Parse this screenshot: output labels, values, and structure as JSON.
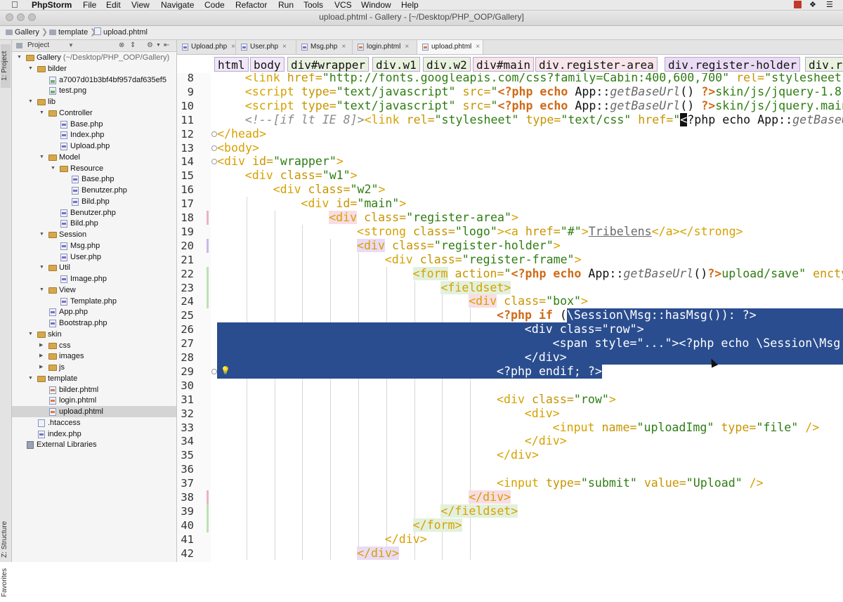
{
  "menubar": {
    "app_name": "PhpStorm",
    "items": [
      "File",
      "Edit",
      "View",
      "Navigate",
      "Code",
      "Refactor",
      "Run",
      "Tools",
      "VCS",
      "Window",
      "Help"
    ]
  },
  "window": {
    "title": "upload.phtml - Gallery - [~/Desktop/PHP_OOP/Gallery]"
  },
  "breadcrumb": [
    "Gallery",
    "template",
    "upload.phtml"
  ],
  "toolstrip": {
    "project_tab": "1: Project",
    "structure_tab": "Z: Structure",
    "favorites_tab": "Favorites"
  },
  "project_panel": {
    "view_label": "Project",
    "tree": [
      {
        "label": "Gallery",
        "hint": "(~/Desktop/PHP_OOP/Gallery)",
        "kind": "folder",
        "level": 0,
        "open": true
      },
      {
        "label": "bilder",
        "kind": "folder",
        "level": 1,
        "open": true
      },
      {
        "label": "a7007d01b3bf4bf957daf635ef5",
        "kind": "img",
        "level": 2
      },
      {
        "label": "test.png",
        "kind": "img",
        "level": 2
      },
      {
        "label": "lib",
        "kind": "folder",
        "level": 1,
        "open": true
      },
      {
        "label": "Controller",
        "kind": "folder",
        "level": 2,
        "open": true
      },
      {
        "label": "Base.php",
        "kind": "php",
        "level": 3
      },
      {
        "label": "Index.php",
        "kind": "php",
        "level": 3
      },
      {
        "label": "Upload.php",
        "kind": "php",
        "level": 3
      },
      {
        "label": "Model",
        "kind": "folder",
        "level": 2,
        "open": true
      },
      {
        "label": "Resource",
        "kind": "folder",
        "level": 3,
        "open": true
      },
      {
        "label": "Base.php",
        "kind": "php",
        "level": 4
      },
      {
        "label": "Benutzer.php",
        "kind": "php",
        "level": 4
      },
      {
        "label": "Bild.php",
        "kind": "php",
        "level": 4
      },
      {
        "label": "Benutzer.php",
        "kind": "php",
        "level": 3
      },
      {
        "label": "Bild.php",
        "kind": "php",
        "level": 3
      },
      {
        "label": "Session",
        "kind": "folder",
        "level": 2,
        "open": true
      },
      {
        "label": "Msg.php",
        "kind": "php",
        "level": 3
      },
      {
        "label": "User.php",
        "kind": "php",
        "level": 3
      },
      {
        "label": "Util",
        "kind": "folder",
        "level": 2,
        "open": true
      },
      {
        "label": "Image.php",
        "kind": "php",
        "level": 3
      },
      {
        "label": "View",
        "kind": "folder",
        "level": 2,
        "open": true
      },
      {
        "label": "Template.php",
        "kind": "php",
        "level": 3
      },
      {
        "label": "App.php",
        "kind": "php",
        "level": 2
      },
      {
        "label": "Bootstrap.php",
        "kind": "php",
        "level": 2
      },
      {
        "label": "skin",
        "kind": "folder",
        "level": 1,
        "open": true
      },
      {
        "label": "css",
        "kind": "folder",
        "level": 2,
        "open": false
      },
      {
        "label": "images",
        "kind": "folder",
        "level": 2,
        "open": false
      },
      {
        "label": "js",
        "kind": "folder",
        "level": 2,
        "open": false
      },
      {
        "label": "template",
        "kind": "folder",
        "level": 1,
        "open": true
      },
      {
        "label": "bilder.phtml",
        "kind": "html",
        "level": 2
      },
      {
        "label": "login.phtml",
        "kind": "html",
        "level": 2
      },
      {
        "label": "upload.phtml",
        "kind": "html",
        "level": 2,
        "selected": true
      },
      {
        "label": ".htaccess",
        "kind": "file",
        "level": 1
      },
      {
        "label": "index.php",
        "kind": "php",
        "level": 1
      },
      {
        "label": "External Libraries",
        "kind": "lib",
        "level": 0
      }
    ]
  },
  "tabs": [
    {
      "label": "Upload.php",
      "kind": "php"
    },
    {
      "label": "User.php",
      "kind": "php"
    },
    {
      "label": "Msg.php",
      "kind": "php"
    },
    {
      "label": "login.phtml",
      "kind": "html"
    },
    {
      "label": "upload.phtml",
      "kind": "html",
      "active": true
    }
  ],
  "tag_path": [
    "html",
    "body",
    "div#wrapper",
    "div.w1",
    "div.w2",
    "div#main",
    "div.register-area",
    "div.register-holder",
    "div.r"
  ],
  "editor": {
    "lines": [
      {
        "n": 8,
        "indent": 1,
        "tokens": [
          [
            "tg",
            "<link "
          ],
          [
            "at",
            "href="
          ],
          [
            "st",
            "\"http://fonts.googleapis.com/css?family=Cabin:400,600,700\" "
          ],
          [
            "at",
            "rel="
          ],
          [
            "st",
            "\"stylesheet\""
          ]
        ]
      },
      {
        "n": 9,
        "indent": 1,
        "tokens": [
          [
            "tg",
            "<script "
          ],
          [
            "at",
            "type="
          ],
          [
            "st",
            "\"text/javascript\" "
          ],
          [
            "at",
            "src="
          ],
          [
            "st",
            "\""
          ],
          [
            "ph",
            "<?php echo "
          ],
          [
            "tx",
            "App::"
          ],
          [
            "ui",
            "getBaseUrl"
          ],
          [
            "tx",
            "() "
          ],
          [
            "ph",
            "?>"
          ],
          [
            "st",
            "skin/js/jquery-1.8."
          ]
        ]
      },
      {
        "n": 10,
        "indent": 1,
        "tokens": [
          [
            "tg",
            "<script "
          ],
          [
            "at",
            "type="
          ],
          [
            "st",
            "\"text/javascript\" "
          ],
          [
            "at",
            "src="
          ],
          [
            "st",
            "\""
          ],
          [
            "ph",
            "<?php echo "
          ],
          [
            "tx",
            "App::"
          ],
          [
            "ui",
            "getBaseUrl"
          ],
          [
            "tx",
            "() "
          ],
          [
            "ph",
            "?>"
          ],
          [
            "st",
            "skin/js/jquery.main"
          ]
        ]
      },
      {
        "n": 11,
        "indent": 1,
        "tokens": [
          [
            "cm",
            "<!--[if lt IE 8]>"
          ],
          [
            "tg",
            "<link "
          ],
          [
            "at",
            "rel="
          ],
          [
            "st",
            "\"stylesheet\" "
          ],
          [
            "at",
            "type="
          ],
          [
            "st",
            "\"text/css\" "
          ],
          [
            "at",
            "href="
          ],
          [
            "st",
            "\""
          ],
          [
            "cur",
            "<"
          ],
          [
            "tx",
            "?php echo App::"
          ],
          [
            "ui",
            "getBaseUrl"
          ]
        ]
      },
      {
        "n": 12,
        "indent": 0,
        "tokens": [
          [
            "tg",
            "</head>"
          ]
        ]
      },
      {
        "n": 13,
        "indent": 0,
        "tokens": [
          [
            "tg",
            "<body>"
          ]
        ]
      },
      {
        "n": 14,
        "indent": 0,
        "tokens": [
          [
            "tg",
            "<div "
          ],
          [
            "at",
            "id="
          ],
          [
            "st",
            "\"wrapper\""
          ],
          [
            "tg",
            ">"
          ]
        ]
      },
      {
        "n": 15,
        "indent": 1,
        "tokens": [
          [
            "tg",
            "<div "
          ],
          [
            "at",
            "class="
          ],
          [
            "st",
            "\"w1\""
          ],
          [
            "tg",
            ">"
          ]
        ]
      },
      {
        "n": 16,
        "indent": 2,
        "tokens": [
          [
            "tg",
            "<div "
          ],
          [
            "at",
            "class="
          ],
          [
            "st",
            "\"w2\""
          ],
          [
            "tg",
            ">"
          ]
        ]
      },
      {
        "n": 17,
        "indent": 3,
        "tokens": [
          [
            "tg",
            "<div "
          ],
          [
            "at",
            "id="
          ],
          [
            "st",
            "\"main\""
          ],
          [
            "tg",
            ">"
          ]
        ]
      },
      {
        "n": 18,
        "indent": 4,
        "tokens": [
          [
            "h1",
            "<div"
          ],
          [
            "at",
            " class="
          ],
          [
            "st",
            "\"register-area\""
          ],
          [
            "tg",
            ">"
          ]
        ]
      },
      {
        "n": 19,
        "indent": 5,
        "tokens": [
          [
            "tg",
            "<strong "
          ],
          [
            "at",
            "class="
          ],
          [
            "st",
            "\"logo\""
          ],
          [
            "tg",
            "><a "
          ],
          [
            "at",
            "href="
          ],
          [
            "st",
            "\"#\""
          ],
          [
            "tg",
            ">"
          ],
          [
            "lk",
            "Tribelens"
          ],
          [
            "tg",
            "</a></strong>"
          ]
        ]
      },
      {
        "n": 20,
        "indent": 5,
        "tokens": [
          [
            "h2",
            "<div"
          ],
          [
            "at",
            " class="
          ],
          [
            "st",
            "\"register-holder\""
          ],
          [
            "tg",
            ">"
          ]
        ]
      },
      {
        "n": 21,
        "indent": 6,
        "tokens": [
          [
            "tg",
            "<div "
          ],
          [
            "at",
            "class="
          ],
          [
            "st",
            "\"register-frame\""
          ],
          [
            "tg",
            ">"
          ]
        ]
      },
      {
        "n": 22,
        "indent": 7,
        "tokens": [
          [
            "h3",
            "<form"
          ],
          [
            "at",
            " action="
          ],
          [
            "st",
            "\""
          ],
          [
            "ph",
            "<?php echo "
          ],
          [
            "tx",
            "App::"
          ],
          [
            "ui",
            "getBaseUrl"
          ],
          [
            "tx",
            "()"
          ],
          [
            "ph",
            "?>"
          ],
          [
            "st",
            "upload/save\" "
          ],
          [
            "at",
            "encty"
          ]
        ]
      },
      {
        "n": 23,
        "indent": 8,
        "tokens": [
          [
            "h3",
            "<fieldset>"
          ]
        ]
      },
      {
        "n": 24,
        "indent": 9,
        "tokens": [
          [
            "h1",
            "<div"
          ],
          [
            "at",
            " class="
          ],
          [
            "st",
            "\"box\""
          ],
          [
            "tg",
            ">"
          ]
        ]
      },
      {
        "n": 25,
        "indent": 10,
        "tokens": [
          [
            "ph",
            "<?php if "
          ],
          [
            "tx",
            "("
          ],
          [
            "sel",
            "\\Session\\Msg::hasMsg()): ?>"
          ]
        ]
      },
      {
        "n": 26,
        "indent": 11,
        "tokens": [
          [
            "sel",
            "<div class=\"row\">"
          ]
        ]
      },
      {
        "n": 27,
        "indent": 12,
        "tokens": [
          [
            "sel",
            "<span style=\"...\"><?php echo \\Session\\Msg:"
          ]
        ]
      },
      {
        "n": 28,
        "indent": 11,
        "tokens": [
          [
            "sel",
            "</div>"
          ]
        ]
      },
      {
        "n": 29,
        "indent": 10,
        "tokens": [
          [
            "sel",
            "<?php endif; ?>"
          ]
        ]
      },
      {
        "n": 30,
        "indent": 0,
        "tokens": []
      },
      {
        "n": 31,
        "indent": 10,
        "tokens": [
          [
            "tg",
            "<div "
          ],
          [
            "at",
            "class="
          ],
          [
            "st",
            "\"row\""
          ],
          [
            "tg",
            ">"
          ]
        ]
      },
      {
        "n": 32,
        "indent": 11,
        "tokens": [
          [
            "tg",
            "<div>"
          ]
        ]
      },
      {
        "n": 33,
        "indent": 12,
        "tokens": [
          [
            "tg",
            "<input "
          ],
          [
            "at",
            "name="
          ],
          [
            "st",
            "\"uploadImg\" "
          ],
          [
            "at",
            "type="
          ],
          [
            "st",
            "\"file\" "
          ],
          [
            "tg",
            "/>"
          ]
        ]
      },
      {
        "n": 34,
        "indent": 11,
        "tokens": [
          [
            "tg",
            "</div>"
          ]
        ]
      },
      {
        "n": 35,
        "indent": 10,
        "tokens": [
          [
            "tg",
            "</div>"
          ]
        ]
      },
      {
        "n": 36,
        "indent": 0,
        "tokens": []
      },
      {
        "n": 37,
        "indent": 10,
        "tokens": [
          [
            "tg",
            "<input "
          ],
          [
            "at",
            "type="
          ],
          [
            "st",
            "\"submit\" "
          ],
          [
            "at",
            "value="
          ],
          [
            "st",
            "\"Upload\" "
          ],
          [
            "tg",
            "/>"
          ]
        ]
      },
      {
        "n": 38,
        "indent": 9,
        "tokens": [
          [
            "h1",
            "</div>"
          ]
        ]
      },
      {
        "n": 39,
        "indent": 8,
        "tokens": [
          [
            "h3",
            "</fieldset>"
          ]
        ]
      },
      {
        "n": 40,
        "indent": 7,
        "tokens": [
          [
            "h3",
            "</form>"
          ]
        ]
      },
      {
        "n": 41,
        "indent": 6,
        "tokens": [
          [
            "tg",
            "</div>"
          ]
        ]
      },
      {
        "n": 42,
        "indent": 5,
        "tokens": [
          [
            "h2",
            "</div>"
          ]
        ]
      }
    ]
  },
  "colors": {
    "selection": "#2a4d8f",
    "tag": "#d7a100",
    "string": "#2e7d12",
    "php_keyword": "#cf6a17"
  }
}
